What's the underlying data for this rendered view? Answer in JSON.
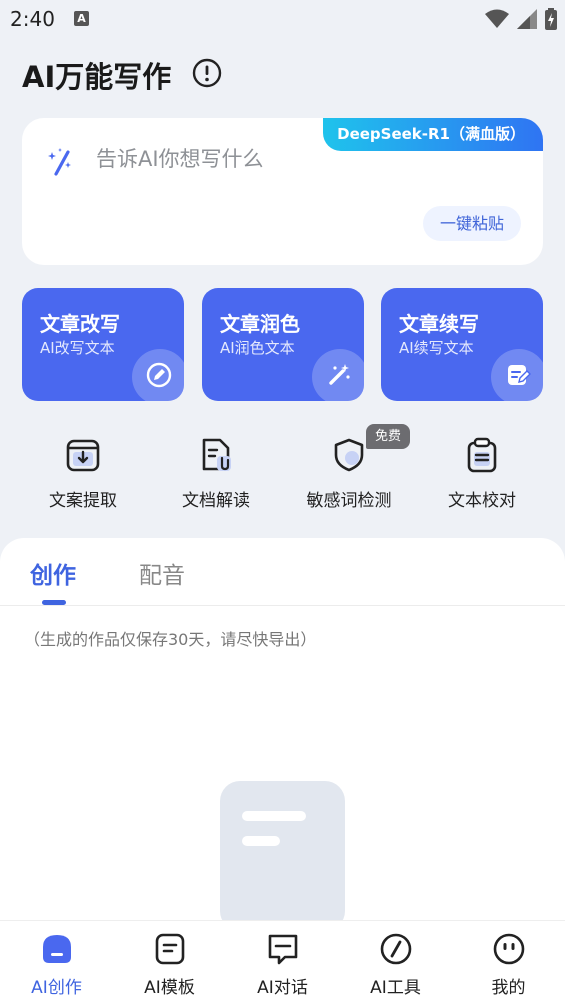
{
  "status_bar": {
    "time": "2:40",
    "notif_letter": "A"
  },
  "header": {
    "title": "AI万能写作"
  },
  "input_card": {
    "model_badge": "DeepSeek-R1（满血版）",
    "placeholder": "告诉AI你想写什么",
    "paste_label": "一键粘贴"
  },
  "features": [
    {
      "title": "文章改写",
      "subtitle": "AI改写文本",
      "icon": "pencil-icon"
    },
    {
      "title": "文章润色",
      "subtitle": "AI润色文本",
      "icon": "magic-wand-icon"
    },
    {
      "title": "文章续写",
      "subtitle": "AI续写文本",
      "icon": "edit-note-icon"
    }
  ],
  "tools": [
    {
      "label": "文案提取",
      "icon": "download-box-icon"
    },
    {
      "label": "文档解读",
      "icon": "document-clip-icon"
    },
    {
      "label": "敏感词检测",
      "icon": "shield-icon"
    },
    {
      "label": "文本校对",
      "icon": "clipboard-icon"
    }
  ],
  "free_badge": "免费",
  "tabs": {
    "active": "创作",
    "inactive": "配音"
  },
  "notice": "（生成的作品仅保存30天，请尽快导出）",
  "bottom_nav": [
    {
      "label": "AI创作",
      "icon": "create-icon",
      "active": true
    },
    {
      "label": "AI模板",
      "icon": "template-icon"
    },
    {
      "label": "AI对话",
      "icon": "chat-icon"
    },
    {
      "label": "AI工具",
      "icon": "tool-icon"
    },
    {
      "label": "我的",
      "icon": "profile-icon"
    }
  ],
  "colors": {
    "accent": "#4a68ef",
    "tab_active": "#3f64e0",
    "badge_start": "#1fc3ec",
    "badge_end": "#2f74f3"
  }
}
